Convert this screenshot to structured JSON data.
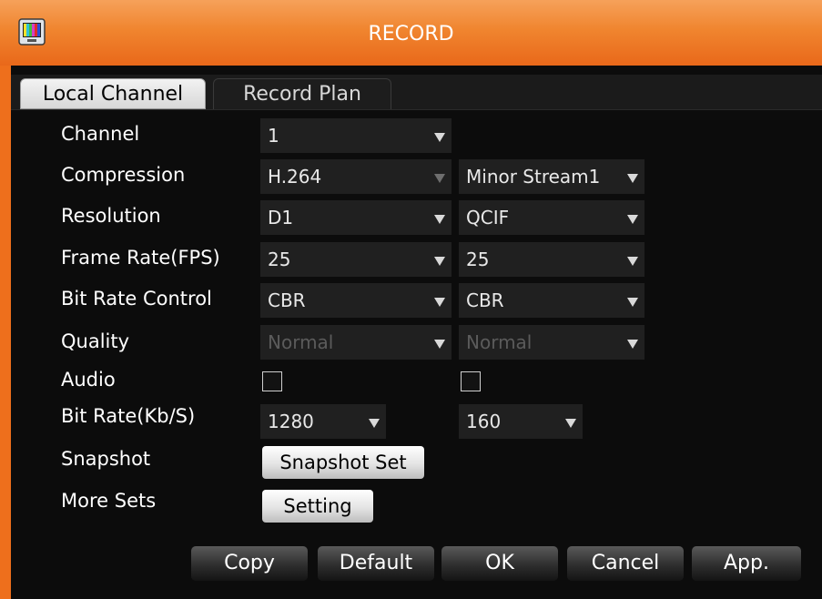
{
  "window": {
    "title": "RECORD"
  },
  "colors": {
    "accent": "#f0852f",
    "panel_bg": "#0c0c0c",
    "field_bg": "#202020",
    "disabled_text": "#5b5b5b"
  },
  "tabs": [
    {
      "label": "Local Channel",
      "active": true
    },
    {
      "label": "Record Plan",
      "active": false
    }
  ],
  "form": {
    "channel": {
      "label": "Channel",
      "value": "1"
    },
    "compression": {
      "label": "Compression",
      "main": "H.264",
      "sub": "Minor Stream1"
    },
    "resolution": {
      "label": "Resolution",
      "main": "D1",
      "sub": "QCIF"
    },
    "frame_rate": {
      "label": "Frame Rate(FPS)",
      "main": "25",
      "sub": "25"
    },
    "bit_rate_control": {
      "label": "Bit Rate Control",
      "main": "CBR",
      "sub": "CBR"
    },
    "quality": {
      "label": "Quality",
      "main": "Normal",
      "sub": "Normal",
      "disabled": true
    },
    "audio": {
      "label": "Audio",
      "main_checked": false,
      "sub_checked": false
    },
    "bit_rate": {
      "label": "Bit Rate(Kb/S)",
      "main": "1280",
      "sub": "160"
    },
    "snapshot": {
      "label": "Snapshot",
      "button": "Snapshot Set"
    },
    "more_sets": {
      "label": "More Sets",
      "button": "Setting"
    }
  },
  "footer": {
    "copy": "Copy",
    "default": "Default",
    "ok": "OK",
    "cancel": "Cancel",
    "apply": "App."
  },
  "icons": {
    "app": "color-bars-monitor-icon",
    "dropdown": "triangle-down-icon"
  }
}
